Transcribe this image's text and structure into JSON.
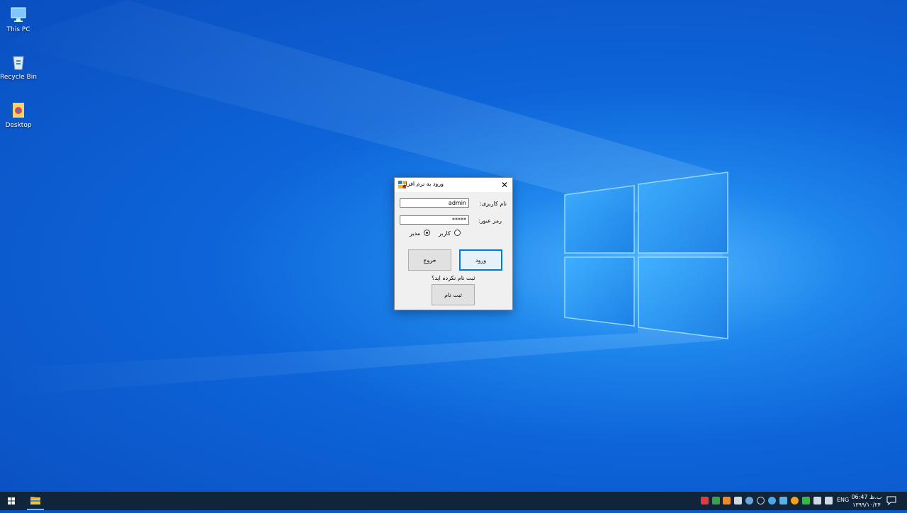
{
  "desktop": {
    "icons": [
      {
        "label": "This PC",
        "icon": "this-pc-icon"
      },
      {
        "label": "Recycle Bin",
        "icon": "recycle-bin-icon"
      },
      {
        "label": "Desktop",
        "icon": "folder-icon"
      }
    ]
  },
  "dialog": {
    "title": "ورود به نرم افزار",
    "close_symbol": "✕",
    "username_label": "نام کاربری:",
    "username_value": "admin",
    "password_label": "رمز عبور:",
    "password_value": "*****",
    "radio_user_label": "کاربر",
    "radio_admin_label": "مدیر",
    "radio_selected": "admin",
    "login_button": "ورود",
    "exit_button": "خروج",
    "not_registered_text": "ثبت نام نکرده اید؟",
    "register_button": "ثبت نام"
  },
  "taskbar": {
    "language": "ENG",
    "clock_time": "06:47 ب.ظ",
    "clock_date": "۱۳۹۹/۱۰/۲۴"
  },
  "colors": {
    "accent": "#0078d7",
    "taskbar": "#10243a",
    "dialog_bg": "#f0f0f0"
  }
}
